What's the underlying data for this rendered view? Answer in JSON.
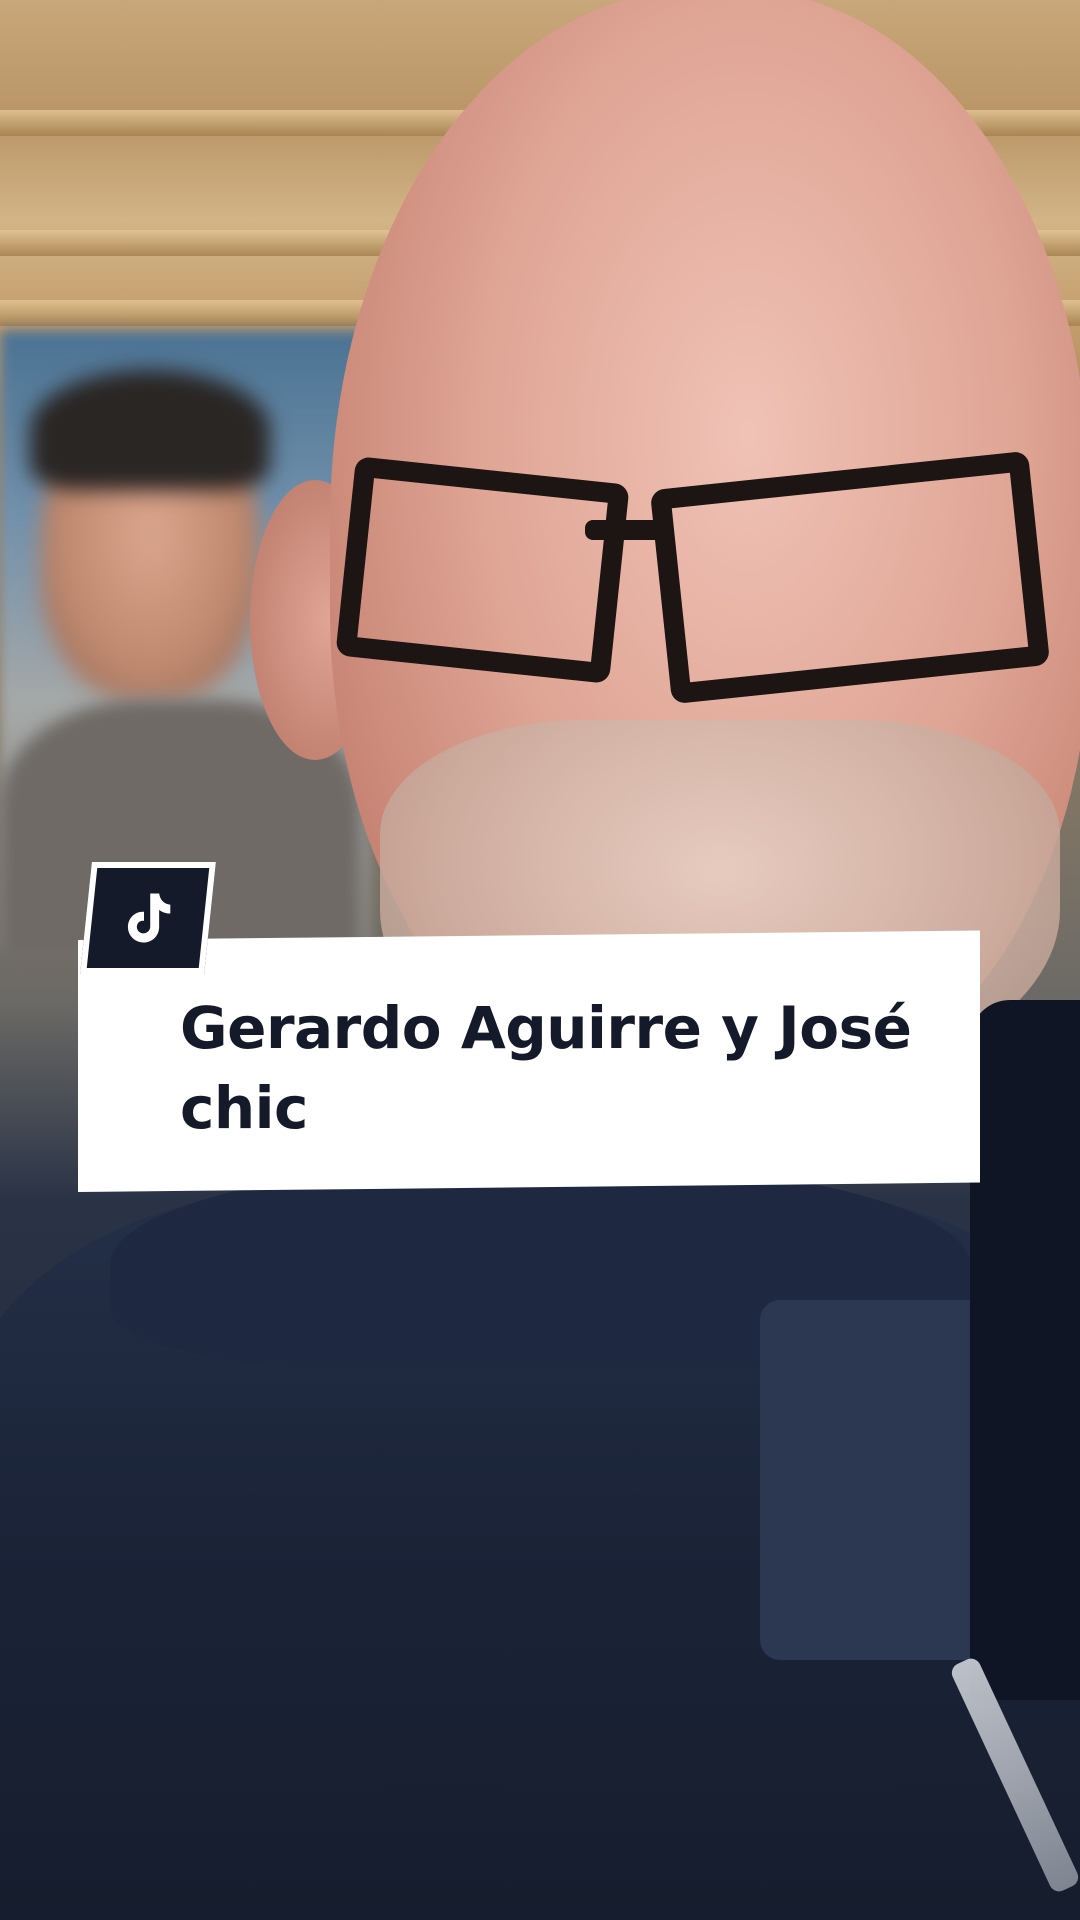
{
  "video": {
    "title_card": {
      "text": "Gerardo Aguirre y José chic"
    },
    "logo": {
      "icon": "tiktok-logo-icon"
    },
    "colors": {
      "card_background": "#ffffff",
      "title_text": "#151a2b",
      "logo_badge": "#151a2b"
    }
  }
}
